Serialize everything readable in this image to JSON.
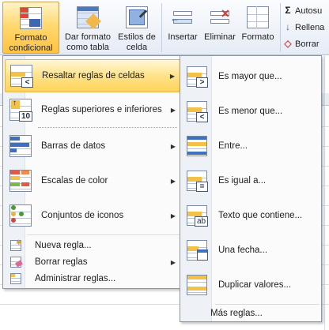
{
  "ribbon": {
    "buttons": [
      {
        "id": "formato-condicional",
        "label": "Formato\ncondicional"
      },
      {
        "id": "dar-formato-tabla",
        "label": "Dar formato\ncomo tabla"
      },
      {
        "id": "estilos-celda",
        "label": "Estilos de\ncelda"
      },
      {
        "id": "insertar",
        "label": "Insertar"
      },
      {
        "id": "eliminar",
        "label": "Eliminar"
      },
      {
        "id": "formato",
        "label": "Formato"
      }
    ],
    "small": [
      {
        "icon": "Σ",
        "label": "Autosu"
      },
      {
        "icon": "↓",
        "label": "Rellena"
      },
      {
        "icon": "◇",
        "label": "Borrar"
      }
    ]
  },
  "menu": {
    "items": [
      {
        "label": "Resaltar reglas de celdas",
        "has_submenu": true
      },
      {
        "label": "Reglas superiores e inferiores",
        "has_submenu": true
      },
      {
        "label": "Barras de datos",
        "has_submenu": true
      },
      {
        "label": "Escalas de color",
        "has_submenu": true
      },
      {
        "label": "Conjuntos de iconos",
        "has_submenu": true
      }
    ],
    "small_items": [
      {
        "label": "Nueva regla..."
      },
      {
        "label": "Borrar reglas",
        "has_submenu": true
      },
      {
        "label": "Administrar reglas..."
      }
    ]
  },
  "submenu": {
    "items": [
      {
        "label": "Es mayor que...",
        "sign": ">"
      },
      {
        "label": "Es menor que...",
        "sign": "<"
      },
      {
        "label": "Entre...",
        "sign": ""
      },
      {
        "label": "Es igual a...",
        "sign": "="
      },
      {
        "label": "Texto que contiene...",
        "sign": "ab"
      },
      {
        "label": "Una fecha...",
        "sign": ""
      },
      {
        "label": "Duplicar valores...",
        "sign": ""
      }
    ],
    "more": "Más reglas..."
  },
  "colors": {
    "highlight": "#ffd35a",
    "ribbon_bg": "#eef2f8",
    "menu_bg": "#fbfbfb"
  }
}
